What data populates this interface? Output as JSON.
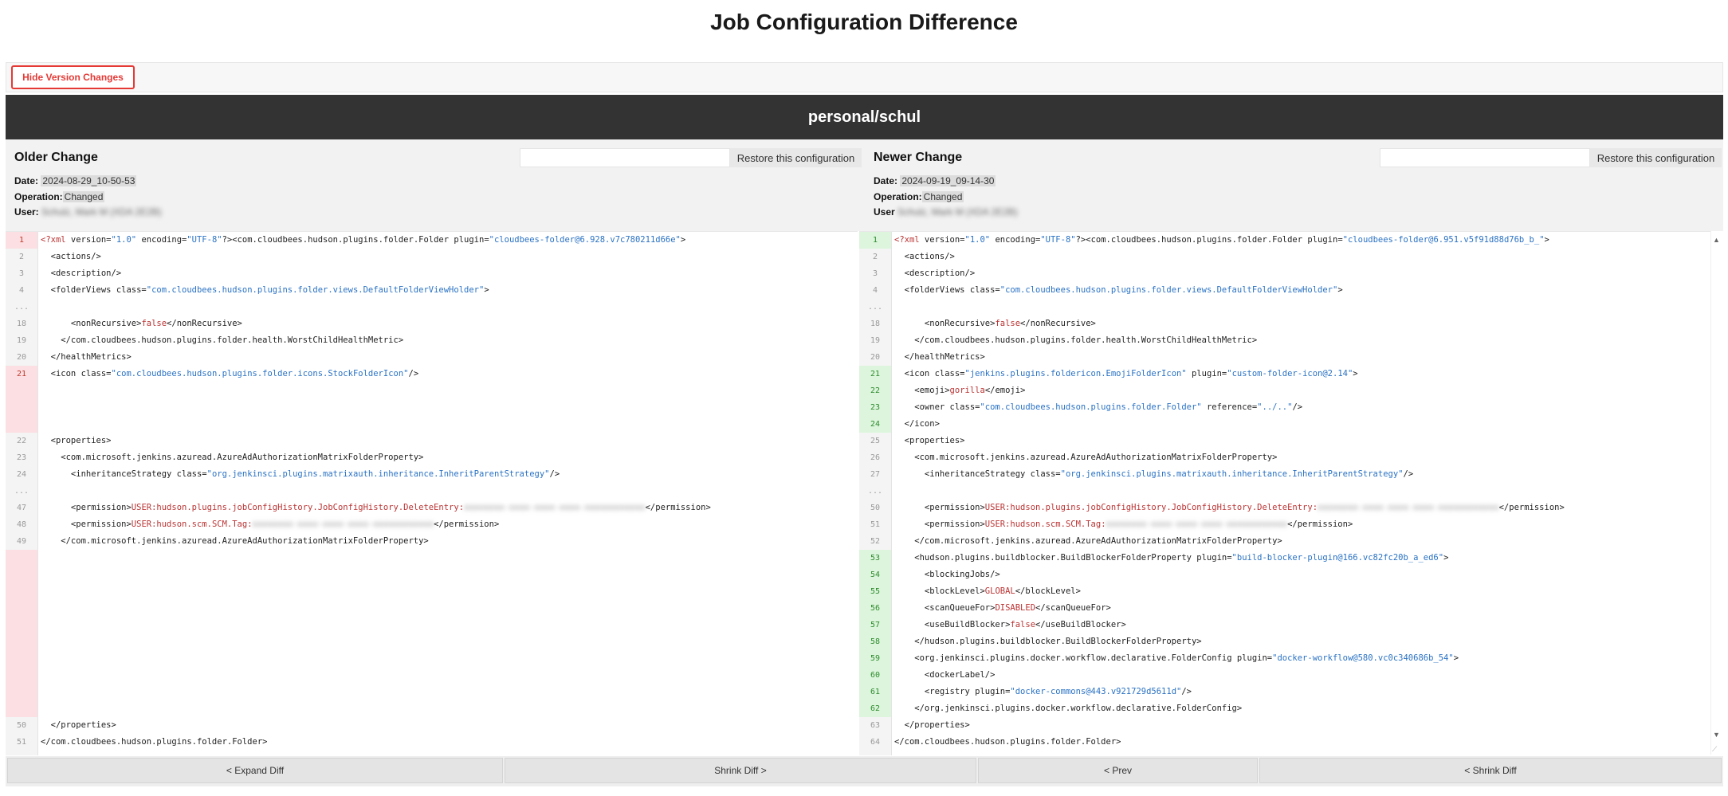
{
  "page": {
    "title": "Job Configuration Difference"
  },
  "toolbar": {
    "hide_label": "Hide Version Changes"
  },
  "job": {
    "name": "personal/schul"
  },
  "left": {
    "heading": "Older Change",
    "restore_label": "Restore this configuration",
    "date_label": "Date:",
    "date": "2024-08-29_10-50-53",
    "op_label": "Operation:",
    "op": "Changed",
    "user_label": "User:",
    "user": "Schulz, Mark M (XDA 2E2B)"
  },
  "right": {
    "heading": "Newer Change",
    "restore_label": "Restore this configuration",
    "date_label": "Date:",
    "date": "2024-09-19_09-14-30",
    "op_label": "Operation:",
    "op": "Changed",
    "user_label": "User",
    "user": "Schulz, Mark M (XDA 2E2B)"
  },
  "nav": {
    "expand": "< Expand Diff",
    "shrink_right": "Shrink Diff >",
    "prev": "< Prev",
    "shrink_left": "< Shrink Diff"
  },
  "diff_left": [
    {
      "n": "1",
      "k": "del",
      "t": "<?xml version=\"1.0\" encoding=\"UTF-8\"?><com.cloudbees.hudson.plugins.folder.Folder plugin=\"cloudbees-folder@6.928.v7c780211d66e\">"
    },
    {
      "n": "2",
      "k": "",
      "t": "  <actions/>"
    },
    {
      "n": "3",
      "k": "",
      "t": "  <description/>"
    },
    {
      "n": "4",
      "k": "",
      "t": "  <folderViews class=\"com.cloudbees.hudson.plugins.folder.views.DefaultFolderViewHolder\">"
    },
    {
      "n": "...",
      "k": "",
      "t": ""
    },
    {
      "n": "18",
      "k": "",
      "t": "      <nonRecursive>false</nonRecursive>"
    },
    {
      "n": "19",
      "k": "",
      "t": "    </com.cloudbees.hudson.plugins.folder.health.WorstChildHealthMetric>"
    },
    {
      "n": "20",
      "k": "",
      "t": "  </healthMetrics>"
    },
    {
      "n": "21",
      "k": "del",
      "t": "  <icon class=\"com.cloudbees.hudson.plugins.folder.icons.StockFolderIcon\"/>"
    },
    {
      "n": "",
      "k": "del",
      "t": ""
    },
    {
      "n": "",
      "k": "del",
      "t": ""
    },
    {
      "n": "",
      "k": "del",
      "t": ""
    },
    {
      "n": "22",
      "k": "",
      "t": "  <properties>"
    },
    {
      "n": "23",
      "k": "",
      "t": "    <com.microsoft.jenkins.azuread.AzureAdAuthorizationMatrixFolderProperty>"
    },
    {
      "n": "24",
      "k": "",
      "t": "      <inheritanceStrategy class=\"org.jenkinsci.plugins.matrixauth.inheritance.InheritParentStrategy\"/>"
    },
    {
      "n": "...",
      "k": "",
      "t": ""
    },
    {
      "n": "47",
      "k": "",
      "t": "      <permission>USER:hudson.plugins.jobConfigHistory.JobConfigHistory.DeleteEntry:xxxxxxxx-xxxx-xxxx-xxxx-xxxxxxxxxxxx</permission>"
    },
    {
      "n": "48",
      "k": "",
      "t": "      <permission>USER:hudson.scm.SCM.Tag:xxxxxxxx-xxxx-xxxx-xxxx-xxxxxxxxxxxx</permission>"
    },
    {
      "n": "49",
      "k": "",
      "t": "    </com.microsoft.jenkins.azuread.AzureAdAuthorizationMatrixFolderProperty>"
    },
    {
      "n": "",
      "k": "del",
      "t": ""
    },
    {
      "n": "",
      "k": "del",
      "t": ""
    },
    {
      "n": "",
      "k": "del",
      "t": ""
    },
    {
      "n": "",
      "k": "del",
      "t": ""
    },
    {
      "n": "",
      "k": "del",
      "t": ""
    },
    {
      "n": "",
      "k": "del",
      "t": ""
    },
    {
      "n": "",
      "k": "del",
      "t": ""
    },
    {
      "n": "",
      "k": "del",
      "t": ""
    },
    {
      "n": "",
      "k": "del",
      "t": ""
    },
    {
      "n": "",
      "k": "del",
      "t": ""
    },
    {
      "n": "50",
      "k": "",
      "t": "  </properties>"
    },
    {
      "n": "51",
      "k": "",
      "t": "</com.cloudbees.hudson.plugins.folder.Folder>"
    }
  ],
  "diff_right": [
    {
      "n": "1",
      "k": "add",
      "t": "<?xml version=\"1.0\" encoding=\"UTF-8\"?><com.cloudbees.hudson.plugins.folder.Folder plugin=\"cloudbees-folder@6.951.v5f91d88d76b_b_\">"
    },
    {
      "n": "2",
      "k": "",
      "t": "  <actions/>"
    },
    {
      "n": "3",
      "k": "",
      "t": "  <description/>"
    },
    {
      "n": "4",
      "k": "",
      "t": "  <folderViews class=\"com.cloudbees.hudson.plugins.folder.views.DefaultFolderViewHolder\">"
    },
    {
      "n": "...",
      "k": "",
      "t": ""
    },
    {
      "n": "18",
      "k": "",
      "t": "      <nonRecursive>false</nonRecursive>"
    },
    {
      "n": "19",
      "k": "",
      "t": "    </com.cloudbees.hudson.plugins.folder.health.WorstChildHealthMetric>"
    },
    {
      "n": "20",
      "k": "",
      "t": "  </healthMetrics>"
    },
    {
      "n": "21",
      "k": "add",
      "t": "  <icon class=\"jenkins.plugins.foldericon.EmojiFolderIcon\" plugin=\"custom-folder-icon@2.14\">"
    },
    {
      "n": "22",
      "k": "add",
      "t": "    <emoji>gorilla</emoji>"
    },
    {
      "n": "23",
      "k": "add",
      "t": "    <owner class=\"com.cloudbees.hudson.plugins.folder.Folder\" reference=\"../..\"/>"
    },
    {
      "n": "24",
      "k": "add",
      "t": "  </icon>"
    },
    {
      "n": "25",
      "k": "",
      "t": "  <properties>"
    },
    {
      "n": "26",
      "k": "",
      "t": "    <com.microsoft.jenkins.azuread.AzureAdAuthorizationMatrixFolderProperty>"
    },
    {
      "n": "27",
      "k": "",
      "t": "      <inheritanceStrategy class=\"org.jenkinsci.plugins.matrixauth.inheritance.InheritParentStrategy\"/>"
    },
    {
      "n": "...",
      "k": "",
      "t": ""
    },
    {
      "n": "50",
      "k": "",
      "t": "      <permission>USER:hudson.plugins.jobConfigHistory.JobConfigHistory.DeleteEntry:xxxxxxxx-xxxx-xxxx-xxxx-xxxxxxxxxxxx</permission>"
    },
    {
      "n": "51",
      "k": "",
      "t": "      <permission>USER:hudson.scm.SCM.Tag:xxxxxxxx-xxxx-xxxx-xxxx-xxxxxxxxxxxx</permission>"
    },
    {
      "n": "52",
      "k": "",
      "t": "    </com.microsoft.jenkins.azuread.AzureAdAuthorizationMatrixFolderProperty>"
    },
    {
      "n": "53",
      "k": "add",
      "t": "    <hudson.plugins.buildblocker.BuildBlockerFolderProperty plugin=\"build-blocker-plugin@166.vc82fc20b_a_ed6\">"
    },
    {
      "n": "54",
      "k": "add",
      "t": "      <blockingJobs/>"
    },
    {
      "n": "55",
      "k": "add",
      "t": "      <blockLevel>GLOBAL</blockLevel>"
    },
    {
      "n": "56",
      "k": "add",
      "t": "      <scanQueueFor>DISABLED</scanQueueFor>"
    },
    {
      "n": "57",
      "k": "add",
      "t": "      <useBuildBlocker>false</useBuildBlocker>"
    },
    {
      "n": "58",
      "k": "add",
      "t": "    </hudson.plugins.buildblocker.BuildBlockerFolderProperty>"
    },
    {
      "n": "59",
      "k": "add",
      "t": "    <org.jenkinsci.plugins.docker.workflow.declarative.FolderConfig plugin=\"docker-workflow@580.vc0c340686b_54\">"
    },
    {
      "n": "60",
      "k": "add",
      "t": "      <dockerLabel/>"
    },
    {
      "n": "61",
      "k": "add",
      "t": "      <registry plugin=\"docker-commons@443.v921729d5611d\"/>"
    },
    {
      "n": "62",
      "k": "add",
      "t": "    </org.jenkinsci.plugins.docker.workflow.declarative.FolderConfig>"
    },
    {
      "n": "63",
      "k": "",
      "t": "  </properties>"
    },
    {
      "n": "64",
      "k": "",
      "t": "</com.cloudbees.hudson.plugins.folder.Folder>"
    }
  ],
  "colors": {
    "deleted": "#fbdfe3",
    "added": "#dcf5dc",
    "header_bar": "#333333",
    "accent_red": "#e53935"
  }
}
